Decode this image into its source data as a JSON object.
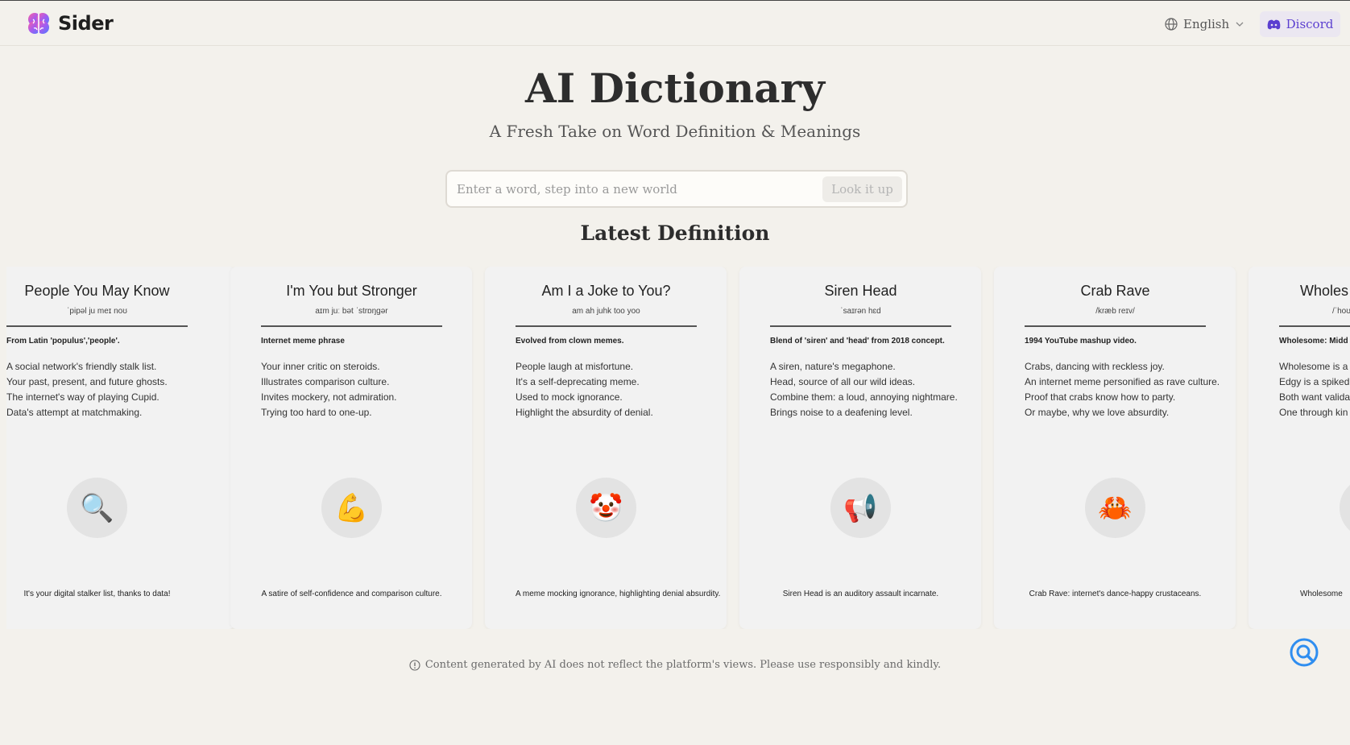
{
  "header": {
    "brand": "Sider",
    "language": "English",
    "discord_label": "Discord"
  },
  "hero": {
    "title": "AI Dictionary",
    "subtitle": "A Fresh Take on Word Definition & Meanings"
  },
  "search": {
    "placeholder": "Enter a word, step into a new world",
    "value": "",
    "button_label": "Look it up"
  },
  "section_title": "Latest Definition",
  "cards": [
    {
      "word": "People You May Know",
      "phonetic": "ˈpipəl ju meɪ noʊ",
      "etymology": "From Latin 'populus','people'.",
      "definitions": [
        "A social network's friendly stalk list.",
        "Your past, present, and future ghosts.",
        "The internet's way of playing Cupid.",
        "Data's attempt at matchmaking."
      ],
      "emoji": "🔍",
      "icon_name": "magnifying-glass-icon",
      "summary": "It's your digital stalker list, thanks to data!"
    },
    {
      "word": "I'm You but Stronger",
      "phonetic": "aɪm juː bət ˈstrɒŋɡər",
      "etymology": "Internet meme phrase",
      "definitions": [
        "Your inner critic on steroids.",
        "Illustrates comparison culture.",
        "Invites mockery, not admiration.",
        "Trying too hard to one-up."
      ],
      "emoji": "💪",
      "icon_name": "flexed-biceps-icon",
      "summary": "A satire of self-confidence and comparison culture."
    },
    {
      "word": "Am I a Joke to You?",
      "phonetic": "am ah juhk too yoo",
      "etymology": "Evolved from clown memes.",
      "definitions": [
        "People laugh at misfortune.",
        "It's a self-deprecating meme.",
        "Used to mock ignorance.",
        "Highlight the absurdity of denial."
      ],
      "emoji": "🤡",
      "icon_name": "clown-face-icon",
      "summary": "A meme mocking ignorance, highlighting denial absurdity."
    },
    {
      "word": "Siren Head",
      "phonetic": "ˈsaɪrən hɛd",
      "etymology": "Blend of 'siren' and 'head' from 2018 concept.",
      "definitions": [
        "A siren, nature's megaphone.",
        "Head, source of all our wild ideas.",
        "Combine them: a loud, annoying nightmare.",
        "Brings noise to a deafening level."
      ],
      "emoji": "📢",
      "icon_name": "megaphone-icon",
      "summary": "Siren Head is an auditory assault incarnate."
    },
    {
      "word": "Crab Rave",
      "phonetic": "/kræb reɪv/",
      "etymology": "1994 YouTube mashup video.",
      "definitions": [
        "Crabs, dancing with reckless joy.",
        "An internet meme personified as rave culture.",
        "Proof that crabs know how to party.",
        "Or maybe, why we love absurdity."
      ],
      "emoji": "🦀",
      "icon_name": "crab-icon",
      "summary": "Crab Rave: internet's dance-happy crustaceans."
    },
    {
      "word": "Wholes",
      "phonetic": "/ˈhoʊ",
      "etymology": "Wholesome: Midd",
      "definitions": [
        "Wholesome is a",
        "Edgy is a spiked",
        "Both want valida",
        "One through kin"
      ],
      "emoji": "🦀",
      "icon_name": "partial-card-icon",
      "summary": "Wholesome"
    }
  ],
  "footer_note": "Content generated by AI does not reflect the platform's views. Please use responsibly and kindly."
}
